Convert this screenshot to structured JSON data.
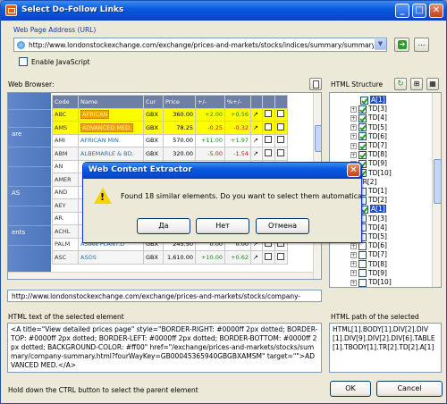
{
  "window": {
    "title": "Select Do-Follow Links",
    "controls": [
      "minimize",
      "maximize",
      "close"
    ]
  },
  "address": {
    "label": "Web Page Address (URL)",
    "value": "http://www.londonstockexchange.com/exchange/prices-and-markets/stocks/indices/summary/summary-in",
    "enable_js_label": "Enable JavaScript",
    "enable_js_checked": false
  },
  "browser": {
    "label": "Web Browser:",
    "left_nav": [
      "are",
      "AS",
      "ents"
    ],
    "table": {
      "headers": [
        "Code",
        "Name",
        "Cur",
        "Price",
        "+/-",
        "%+/-",
        "",
        "",
        ""
      ],
      "rows": [
        {
          "code": "ABC",
          "name": "AFRICAN",
          "cur": "GBX",
          "price": "360.00",
          "chg": "+2.00",
          "pct": "+0.56",
          "dir": "pos",
          "selected": true
        },
        {
          "code": "AMS",
          "name": "ADVANCED MED.",
          "cur": "GBX",
          "price": "78.25",
          "chg": "-0.25",
          "pct": "-0.32",
          "dir": "neg",
          "selected": true
        },
        {
          "code": "AMI",
          "name": "AFRICAN MIN.",
          "cur": "GBX",
          "price": "570.00",
          "chg": "+11.00",
          "pct": "+1.97",
          "dir": "pos",
          "selected": false
        },
        {
          "code": "ABM",
          "name": "ALBEMARLE & BD.",
          "cur": "GBX",
          "price": "320.00",
          "chg": "-5.00",
          "pct": "-1.54",
          "dir": "neg",
          "selected": false
        },
        {
          "code": "AN",
          "name": "",
          "cur": "",
          "price": "",
          "chg": "",
          "pct": "",
          "dir": "",
          "selected": false
        },
        {
          "code": "AMER",
          "name": "",
          "cur": "",
          "price": "",
          "chg": "",
          "pct": "",
          "dir": "",
          "selected": false
        },
        {
          "code": "AND",
          "name": "",
          "cur": "",
          "price": "",
          "chg": "",
          "pct": "",
          "dir": "",
          "selected": false
        },
        {
          "code": "AEY",
          "name": "",
          "cur": "",
          "price": "",
          "chg": "",
          "pct": "",
          "dir": "",
          "selected": false
        },
        {
          "code": "AR.",
          "name": "",
          "cur": "",
          "price": "",
          "chg": "",
          "pct": "",
          "dir": "",
          "selected": false
        },
        {
          "code": "ACHL",
          "name": "",
          "cur": "",
          "price": "",
          "chg": "",
          "pct": "",
          "dir": "",
          "selected": false
        },
        {
          "code": "PALM",
          "name": "ASIAN PLANT.D",
          "cur": "GBX",
          "price": "245.50",
          "chg": "0.00",
          "pct": "0.00",
          "dir": "",
          "selected": false
        },
        {
          "code": "ASC",
          "name": "ASOS",
          "cur": "GBX",
          "price": "1,610.00",
          "chg": "+10.00",
          "pct": "+0.62",
          "dir": "pos",
          "selected": false
        }
      ]
    },
    "status_url": "http://www.londonstockexchange.com/exchange/prices-and-markets/stocks/company-"
  },
  "structure": {
    "label": "HTML Structure",
    "nodes": [
      {
        "text": "A[1]",
        "checked": true,
        "indent": 2,
        "highlight": true,
        "pm": ""
      },
      {
        "text": "TD[3]",
        "checked": true,
        "indent": 1,
        "highlight": false,
        "pm": "+"
      },
      {
        "text": "TD[4]",
        "checked": true,
        "indent": 1,
        "highlight": false,
        "pm": "+"
      },
      {
        "text": "TD[5]",
        "checked": true,
        "indent": 1,
        "highlight": false,
        "pm": "+"
      },
      {
        "text": "TD[6]",
        "checked": true,
        "indent": 1,
        "highlight": false,
        "pm": "+"
      },
      {
        "text": "TD[7]",
        "checked": true,
        "indent": 1,
        "highlight": false,
        "pm": "+"
      },
      {
        "text": "TD[8]",
        "checked": true,
        "indent": 1,
        "highlight": false,
        "pm": "+"
      },
      {
        "text": "TD[9]",
        "checked": true,
        "indent": 1,
        "highlight": false,
        "pm": "+"
      },
      {
        "text": "TD[10]",
        "checked": true,
        "indent": 1,
        "highlight": false,
        "pm": "+"
      },
      {
        "text": "TR[2]",
        "checked": false,
        "indent": 0,
        "highlight": false,
        "pm": "-"
      },
      {
        "text": "TD[1]",
        "checked": false,
        "indent": 1,
        "highlight": false,
        "pm": "+"
      },
      {
        "text": "TD[2]",
        "checked": false,
        "indent": 1,
        "highlight": false,
        "pm": "-"
      },
      {
        "text": "A[1]",
        "checked": true,
        "indent": 2,
        "highlight": true,
        "pm": ""
      },
      {
        "text": "TD[3]",
        "checked": false,
        "indent": 1,
        "highlight": false,
        "pm": "+"
      },
      {
        "text": "TD[4]",
        "checked": false,
        "indent": 1,
        "highlight": false,
        "pm": "+"
      },
      {
        "text": "TD[5]",
        "checked": false,
        "indent": 1,
        "highlight": false,
        "pm": "+"
      },
      {
        "text": "TD[6]",
        "checked": false,
        "indent": 1,
        "highlight": false,
        "pm": "+"
      },
      {
        "text": "TD[7]",
        "checked": false,
        "indent": 1,
        "highlight": false,
        "pm": "+"
      },
      {
        "text": "TD[8]",
        "checked": false,
        "indent": 1,
        "highlight": false,
        "pm": "+"
      },
      {
        "text": "TD[9]",
        "checked": false,
        "indent": 1,
        "highlight": false,
        "pm": "+"
      },
      {
        "text": "TD[10]",
        "checked": false,
        "indent": 1,
        "highlight": false,
        "pm": "+"
      }
    ]
  },
  "html_text": {
    "label": "HTML text of the selected element",
    "value": "<A title=\"View detailed prices page\" style=\"BORDER-RIGHT: #0000ff 2px dotted; BORDER-TOP: #0000ff 2px dotted; BORDER-LEFT: #0000ff 2px dotted; BORDER-BOTTOM: #0000ff 2px dotted; BACKGROUND-COLOR: #ff00\" href=\"/exchange/prices-and-markets/stocks/summary/company-summary.html?fourWayKey=GB00045365940GBGBXAMSM\" target=\"\">ADVANCED MED.</A>"
  },
  "html_path": {
    "label": "HTML path of the selected",
    "value": "HTML[1].BODY[1].DIV[2].DIV[1].DIV[9].DIV[2].DIV[6].TABLE[1].TBODY[1].TR[2].TD[2].A[1]"
  },
  "footer": {
    "hint": "Hold down the CTRL button to select the parent element",
    "ok_label": "OK",
    "cancel_label": "Cancel"
  },
  "dialog": {
    "title": "Web Content Extractor",
    "message": "Found 18 similar elements. Do you want to select them automatically?",
    "yes_label": "Да",
    "no_label": "Нет",
    "cancel_label": "Отмена"
  },
  "colors": {
    "titlebar": "#0a5ae0",
    "dialog_face": "#ece9d8",
    "selected_row": "#fffd00",
    "tree_highlight": "#1a4fc4"
  }
}
